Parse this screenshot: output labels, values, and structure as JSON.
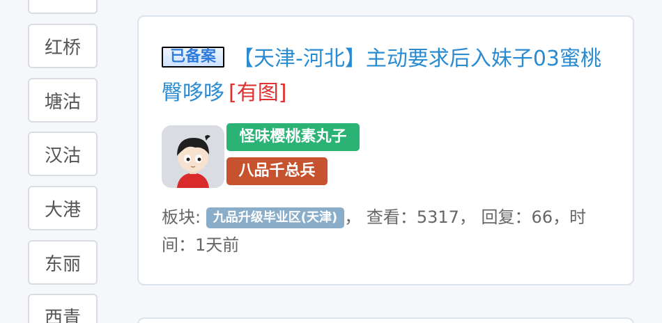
{
  "sidebar": {
    "districts": [
      "",
      "红桥",
      "塘沽",
      "汉沽",
      "大港",
      "东丽",
      "西青"
    ]
  },
  "post": {
    "filed_badge": "已备案",
    "title": "【天津-河北】主动要求后入妹子03蜜桃臀哆哆",
    "has_picture": "[有图]",
    "author": {
      "name": "怪味樱桃素丸子",
      "rank": "八品千总兵"
    },
    "meta": {
      "board_label": "板块:",
      "board": "九品升级毕业区(天津)",
      "sep1": "，",
      "views_label": "查看：",
      "views": "5317",
      "sep2": "，",
      "replies_label": "回复：",
      "replies": "66",
      "sep3": "，",
      "time_label": "时间：",
      "time": "1天前"
    }
  },
  "colors": {
    "title_link": "#2b8bd1",
    "picture_tag": "#e03030",
    "name_tag": "#2bb375",
    "rank_tag": "#c6532e",
    "board_badge": "#8aaec9"
  }
}
